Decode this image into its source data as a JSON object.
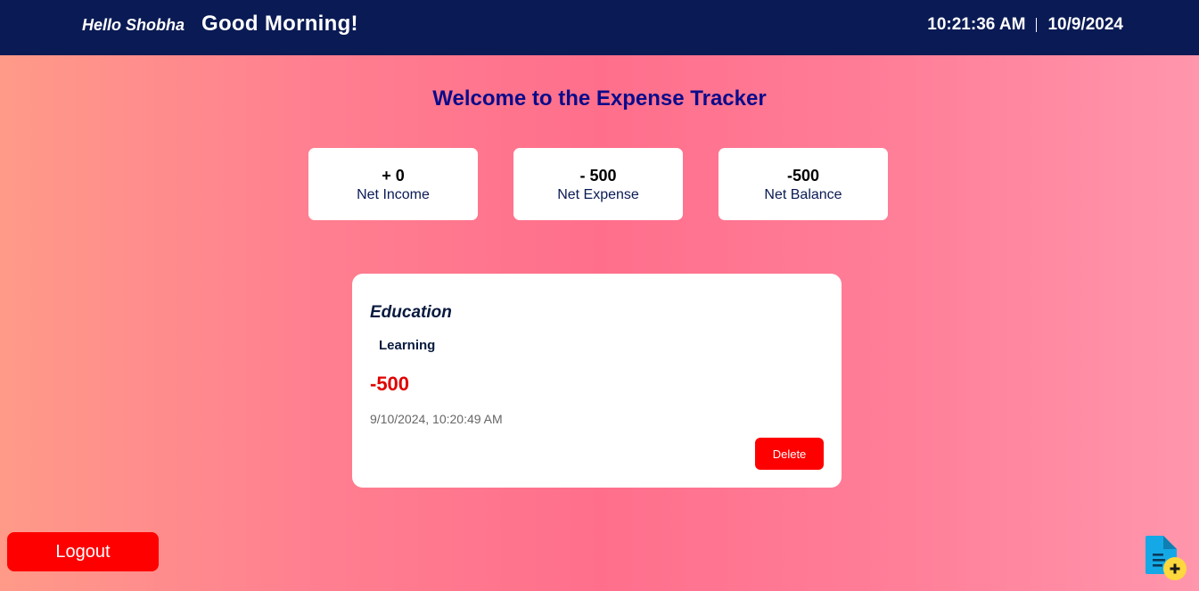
{
  "header": {
    "hello": "Hello Shobha",
    "greeting": "Good Morning!",
    "time": "10:21:36 AM",
    "date": "10/9/2024"
  },
  "welcome_title": "Welcome to the Expense Tracker",
  "summary": [
    {
      "value": "+ 0",
      "label": "Net Income"
    },
    {
      "value": "- 500",
      "label": "Net Expense"
    },
    {
      "value": "-500",
      "label": "Net Balance"
    }
  ],
  "expenses": [
    {
      "category": "Education",
      "description": "Learning",
      "amount": "-500",
      "datetime": "9/10/2024, 10:20:49 AM",
      "delete_label": "Delete"
    }
  ],
  "logout_label": "Logout",
  "icons": {
    "add_expense": "add-document-icon"
  },
  "colors": {
    "header_bg": "#0a1a54",
    "title": "#0b0b8a",
    "expense_amount": "#e00000",
    "danger_button": "#ff0000",
    "icon_doc": "#14a9e6",
    "icon_plus": "#ffd83d"
  }
}
